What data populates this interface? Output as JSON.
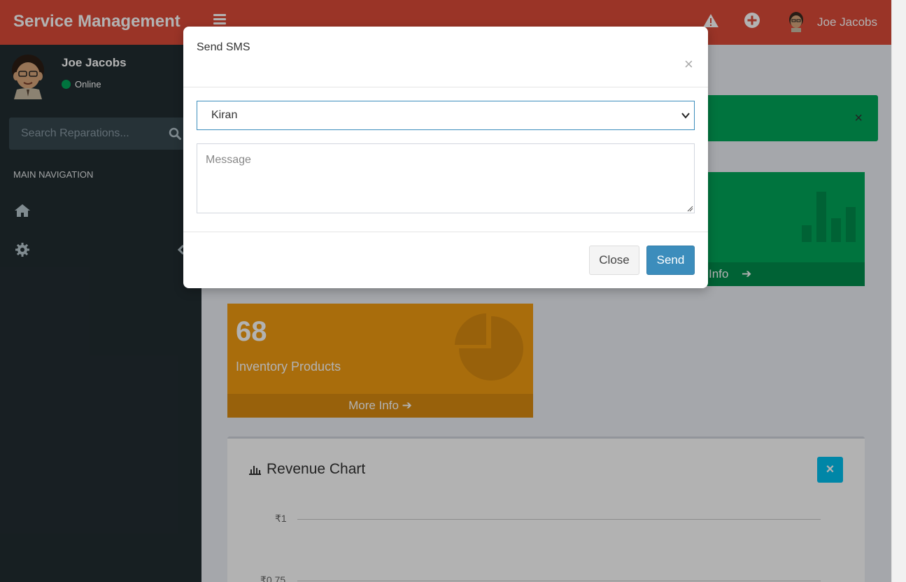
{
  "header": {
    "brand": "Service Management",
    "user_name": "Joe Jacobs",
    "icons": [
      "menu-icon",
      "warning-icon",
      "plus-circle-icon",
      "avatar"
    ]
  },
  "sidebar": {
    "user_name": "Joe Jacobs",
    "status": "Online",
    "search_placeholder": "Search Reparations...",
    "nav_header": "MAIN NAVIGATION",
    "nav_items": [
      {
        "icon": "home-icon"
      },
      {
        "icon": "gear-icon"
      }
    ]
  },
  "content": {
    "green_box_footer": "Info",
    "inventory": {
      "count": "68",
      "label": "Inventory Products",
      "footer": "More Info"
    },
    "chart": {
      "title": "Revenue Chart",
      "close_label": "×",
      "y_ticks": [
        "₹1",
        "₹0.75"
      ]
    }
  },
  "modal": {
    "title": "Send SMS",
    "close_x": "×",
    "recipient_selected": "Kiran",
    "message_placeholder": "Message",
    "close_button": "Close",
    "send_button": "Send"
  },
  "colors": {
    "header": "#dd4b39",
    "sidebar": "#222d32",
    "green": "#00a65a",
    "yellow": "#f39c12",
    "primary": "#3c8dbc",
    "info": "#00c0ef"
  },
  "chart_data": {
    "type": "line",
    "title": "Revenue Chart",
    "y_tick_labels": [
      "₹1",
      "₹0.75"
    ],
    "series": []
  }
}
